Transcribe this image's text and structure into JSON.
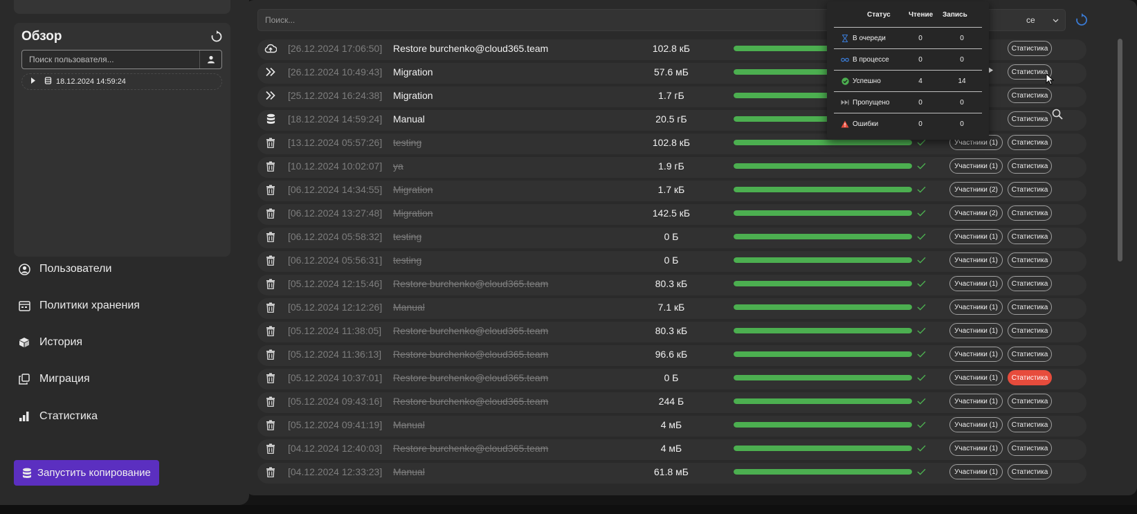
{
  "sidebar": {
    "overview_title": "Обзор",
    "user_search_placeholder": "Поиск пользователя...",
    "tree_node_label": "18.12.2024 14:59:24",
    "nav": [
      {
        "label": "Пользователи",
        "icon": "user-circle-icon"
      },
      {
        "label": "Политики хранения",
        "icon": "calendar-icon"
      },
      {
        "label": "История",
        "icon": "cube-icon"
      },
      {
        "label": "Миграция",
        "icon": "copy-icon"
      },
      {
        "label": "Статистика",
        "icon": "bar-chart-icon"
      }
    ],
    "start_button_label": "Запустить копирование"
  },
  "main": {
    "search_placeholder": "Поиск...",
    "filter_value": "ce",
    "rows": [
      {
        "icon": "cloud-upload-icon",
        "date": "[26.12.2024 17:06:50]",
        "name": "Restore burchenko@cloud365.team",
        "deleted": false,
        "size": "102.8 кБ",
        "participants": "",
        "stats": "Статистика",
        "error": false
      },
      {
        "icon": "double-chevron-icon",
        "date": "[26.12.2024 10:49:43]",
        "name": "Migration",
        "deleted": false,
        "size": "57.6 мБ",
        "participants": "",
        "stats": "Статистика",
        "error": false
      },
      {
        "icon": "double-chevron-icon",
        "date": "[25.12.2024 16:24:38]",
        "name": "Migration",
        "deleted": false,
        "size": "1.7 гБ",
        "participants": "",
        "stats": "Статистика",
        "error": false
      },
      {
        "icon": "database-icon",
        "date": "[18.12.2024 14:59:24]",
        "name": "Manual",
        "deleted": false,
        "size": "20.5 гБ",
        "participants": "",
        "stats": "Статистика",
        "error": false
      },
      {
        "icon": "trash-icon",
        "date": "[13.12.2024 05:57:26]",
        "name": "testing",
        "deleted": true,
        "size": "102.8 кБ",
        "participants": "Участники (1)",
        "stats": "Статистика",
        "error": false
      },
      {
        "icon": "trash-icon",
        "date": "[10.12.2024 10:02:07]",
        "name": "ya",
        "deleted": true,
        "size": "1.9 гБ",
        "participants": "Участники (1)",
        "stats": "Статистика",
        "error": false
      },
      {
        "icon": "trash-icon",
        "date": "[06.12.2024 14:34:55]",
        "name": "Migration",
        "deleted": true,
        "size": "1.7 кБ",
        "participants": "Участники (2)",
        "stats": "Статистика",
        "error": false
      },
      {
        "icon": "trash-icon",
        "date": "[06.12.2024 13:27:48]",
        "name": "Migration",
        "deleted": true,
        "size": "142.5 кБ",
        "participants": "Участники (2)",
        "stats": "Статистика",
        "error": false
      },
      {
        "icon": "trash-icon",
        "date": "[06.12.2024 05:58:32]",
        "name": "testing",
        "deleted": true,
        "size": "0 Б",
        "participants": "Участники (1)",
        "stats": "Статистика",
        "error": false
      },
      {
        "icon": "trash-icon",
        "date": "[06.12.2024 05:56:31]",
        "name": "testing",
        "deleted": true,
        "size": "0 Б",
        "participants": "Участники (1)",
        "stats": "Статистика",
        "error": false
      },
      {
        "icon": "trash-icon",
        "date": "[05.12.2024 12:15:46]",
        "name": "Restore burchenko@cloud365.team",
        "deleted": true,
        "size": "80.3 кБ",
        "participants": "Участники (1)",
        "stats": "Статистика",
        "error": false
      },
      {
        "icon": "trash-icon",
        "date": "[05.12.2024 12:12:26]",
        "name": "Manual",
        "deleted": true,
        "size": "7.1 кБ",
        "participants": "Участники (1)",
        "stats": "Статистика",
        "error": false
      },
      {
        "icon": "trash-icon",
        "date": "[05.12.2024 11:38:05]",
        "name": "Restore burchenko@cloud365.team",
        "deleted": true,
        "size": "80.3 кБ",
        "participants": "Участники (1)",
        "stats": "Статистика",
        "error": false
      },
      {
        "icon": "trash-icon",
        "date": "[05.12.2024 11:36:13]",
        "name": "Restore burchenko@cloud365.team",
        "deleted": true,
        "size": "96.6 кБ",
        "participants": "Участники (1)",
        "stats": "Статистика",
        "error": false
      },
      {
        "icon": "trash-icon",
        "date": "[05.12.2024 10:37:01]",
        "name": "Restore burchenko@cloud365.team",
        "deleted": true,
        "size": "0 Б",
        "participants": "Участники (1)",
        "stats": "Статистика",
        "error": true
      },
      {
        "icon": "trash-icon",
        "date": "[05.12.2024 09:43:16]",
        "name": "Restore burchenko@cloud365.team",
        "deleted": true,
        "size": "244 Б",
        "participants": "Участники (1)",
        "stats": "Статистика",
        "error": false
      },
      {
        "icon": "trash-icon",
        "date": "[05.12.2024 09:41:19]",
        "name": "Manual",
        "deleted": true,
        "size": "4 мБ",
        "participants": "Участники (1)",
        "stats": "Статистика",
        "error": false
      },
      {
        "icon": "trash-icon",
        "date": "[04.12.2024 12:40:03]",
        "name": "Restore burchenko@cloud365.team",
        "deleted": true,
        "size": "4 мБ",
        "participants": "Участники (1)",
        "stats": "Статистика",
        "error": false
      },
      {
        "icon": "trash-icon",
        "date": "[04.12.2024 12:33:23]",
        "name": "Manual",
        "deleted": true,
        "size": "61.8 мБ",
        "participants": "Участники (1)",
        "stats": "Статистика",
        "error": false
      }
    ]
  },
  "status_popup": {
    "headers": {
      "status": "Статус",
      "read": "Чтение",
      "write": "Запись"
    },
    "rows": [
      {
        "icon": "hourglass-icon",
        "label": "В очереди",
        "read": "0",
        "write": "0",
        "color": "#3a7bd5"
      },
      {
        "icon": "infinity-icon",
        "label": "В процессе",
        "read": "0",
        "write": "0",
        "color": "#3a7bd5"
      },
      {
        "icon": "check-circle-icon",
        "label": "Успешно",
        "read": "4",
        "write": "14",
        "color": "#4caf50"
      },
      {
        "icon": "skip-icon",
        "label": "Пропущено",
        "read": "0",
        "write": "0",
        "color": "#9a9a9a"
      },
      {
        "icon": "warning-icon",
        "label": "Ошибки",
        "read": "0",
        "write": "0",
        "color": "#e74c3c"
      }
    ]
  },
  "colors": {
    "accent": "#5b2fc0",
    "progress": "#4caf50",
    "error": "#e74c3c",
    "info": "#3a7bd5"
  }
}
